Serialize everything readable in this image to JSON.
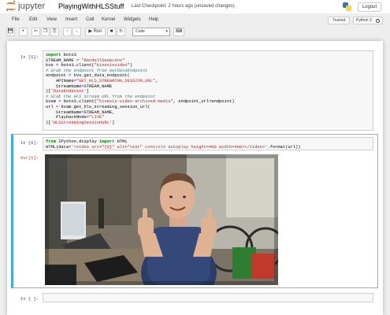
{
  "header": {
    "logo_text": "jupyter",
    "notebook_name": "PlayingWithHLSStuff",
    "checkpoint": "Last Checkpoint: 2 hours ago",
    "unsaved": "(unsaved changes)",
    "logout_label": "Logout"
  },
  "menubar": {
    "items": [
      "File",
      "Edit",
      "View",
      "Insert",
      "Cell",
      "Kernel",
      "Widgets",
      "Help"
    ],
    "trusted_label": "Trusted",
    "kernel_name": "Python 3"
  },
  "toolbar": {
    "run_label": "Run",
    "cell_type": "Code"
  },
  "cells": [
    {
      "prompt": "In [5]:",
      "lines": [
        "import boto3",
        "STREAM_NAME = \"RandallDeepLens\"",
        "kvs = boto3.client(\"kinesisvideo\")",
        "# Grab the endpoint from GetDataEndpoint",
        "endpoint = kvs.get_data_endpoint(",
        "    APIName=\"GET_HLS_STREAMING_SESSION_URL\",",
        "    StreamName=STREAM_NAME",
        ")['DataEndpoint']",
        "# Grab the HLS Stream URL from the endpoint",
        "kvam = boto3.client(\"kinesis-video-archived-media\", endpoint_url=endpoint)",
        "url = kvam.get_hls_streaming_session_url(",
        "    StreamName=STREAM_NAME,",
        "    PlaybackMode=\"LIVE\"",
        ")['HLSStreamingSessionURL']"
      ]
    },
    {
      "prompt": "In [6]:",
      "lines": [
        "from IPython.display import HTML",
        "HTML(data='<video src=\"{0}\" alt=\"test\" controls autoplay height=400 width=400></video>'.format(url))"
      ],
      "out_prompt": "Out[6]:"
    },
    {
      "prompt": "In [ ]:",
      "lines": [
        ""
      ]
    }
  ],
  "colors": {
    "keyword": "#008000",
    "string": "#ba2121",
    "comment": "#408080",
    "operator": "#aa22ff",
    "in_prompt": "#303f9f",
    "out_prompt": "#d84315",
    "selected_border": "#42a5f5",
    "jupyter_orange": "#f37726"
  },
  "icons": [
    "save-icon",
    "add-cell-icon",
    "cut-icon",
    "copy-icon",
    "paste-icon",
    "move-up-icon",
    "move-down-icon",
    "run-icon",
    "stop-icon",
    "restart-icon",
    "fast-forward-icon",
    "keyboard-icon"
  ]
}
